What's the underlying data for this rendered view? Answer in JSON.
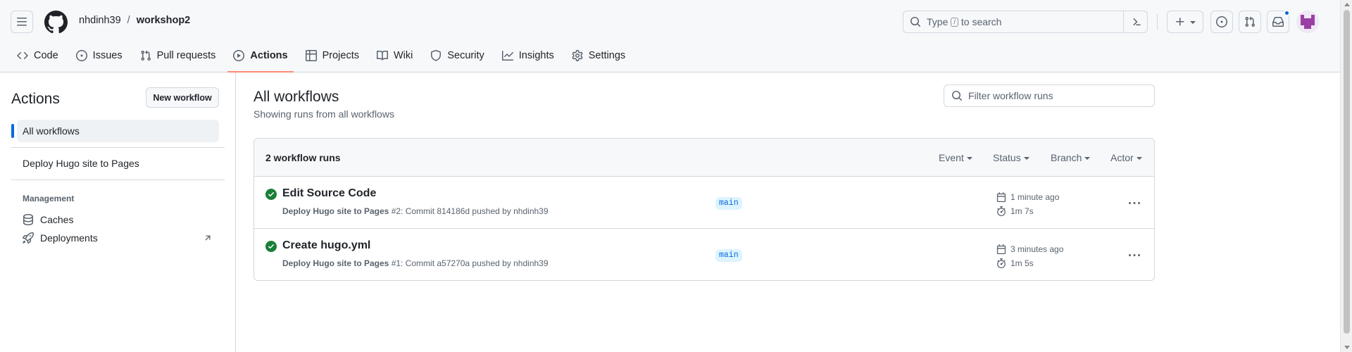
{
  "header": {
    "owner": "nhdinh39",
    "separator": "/",
    "repo": "workshop2",
    "search_prefix": "Type",
    "search_key": "/",
    "search_suffix": "to search"
  },
  "tabs": [
    {
      "label": "Code",
      "icon": "code-icon"
    },
    {
      "label": "Issues",
      "icon": "issue-opened-icon"
    },
    {
      "label": "Pull requests",
      "icon": "git-pull-request-icon"
    },
    {
      "label": "Actions",
      "icon": "play-icon",
      "active": true
    },
    {
      "label": "Projects",
      "icon": "table-icon"
    },
    {
      "label": "Wiki",
      "icon": "book-icon"
    },
    {
      "label": "Security",
      "icon": "shield-icon"
    },
    {
      "label": "Insights",
      "icon": "graph-icon"
    },
    {
      "label": "Settings",
      "icon": "gear-icon"
    }
  ],
  "sidebar": {
    "title": "Actions",
    "new_workflow": "New workflow",
    "items": [
      "All workflows",
      "Deploy Hugo site to Pages"
    ],
    "management_label": "Management",
    "links": [
      "Caches",
      "Deployments"
    ]
  },
  "main": {
    "title": "All workflows",
    "subtitle": "Showing runs from all workflows",
    "filter_placeholder": "Filter workflow runs",
    "runs_count": "2 workflow runs",
    "filters": [
      "Event",
      "Status",
      "Branch",
      "Actor"
    ],
    "runs": [
      {
        "title": "Edit Source Code",
        "workflow": "Deploy Hugo site to Pages",
        "meta": " #2: Commit 814186d pushed by nhdinh39",
        "branch": "main",
        "when": "1 minute ago",
        "duration": "1m 7s",
        "status": "success"
      },
      {
        "title": "Create hugo.yml",
        "workflow": "Deploy Hugo site to Pages",
        "meta": " #1: Commit a57270a pushed by nhdinh39",
        "branch": "main",
        "when": "3 minutes ago",
        "duration": "1m 5s",
        "status": "success"
      }
    ]
  },
  "colors": {
    "accent": "#0969da",
    "success": "#1a7f37",
    "active_tab_underline": "#fd8c73"
  }
}
